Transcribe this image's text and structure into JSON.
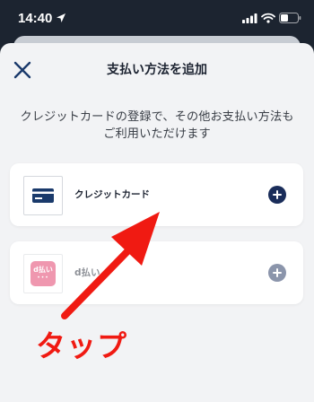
{
  "status_bar": {
    "time": "14:40"
  },
  "sheet": {
    "title": "支払い方法を追加",
    "info_line1": "クレジットカードの登録で、その他お支払い方法も",
    "info_line2": "ご利用いただけます"
  },
  "payment_methods": [
    {
      "label": "クレジットカード",
      "icon": "credit-card-icon",
      "enabled": true
    },
    {
      "label": "d払い",
      "icon": "d-barai-logo",
      "logo_text": "d払い",
      "enabled": false
    }
  ],
  "annotation": {
    "label": "タップ",
    "color": "#f01a12"
  },
  "colors": {
    "accent": "#1a2d5a",
    "dpay_brand": "#e03162"
  }
}
